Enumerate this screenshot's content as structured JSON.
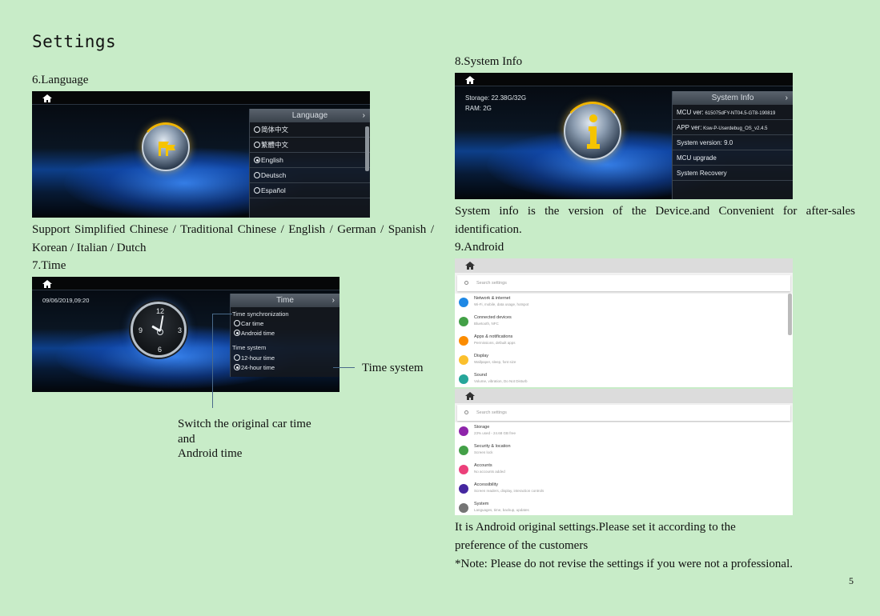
{
  "page": {
    "title": "Settings",
    "number": "5"
  },
  "language": {
    "label": "6.Language",
    "panel_title": "Language",
    "options": [
      "简体中文",
      "繁體中文",
      "English",
      "Deutsch",
      "Español"
    ],
    "selected": 2,
    "description": "Support Simplified Chinese / Traditional Chinese / English / German / Spanish / Korean / Italian / Dutch"
  },
  "time": {
    "label": "7.Time",
    "datetime": "09/06/2019,09:20",
    "panel_title": "Time",
    "sync_title": "Time synchronization",
    "sync_options": [
      "Car time",
      "Android time"
    ],
    "sync_selected": 1,
    "system_title": "Time system",
    "system_options": [
      "12-hour time",
      "24-hour time"
    ],
    "system_selected": 1,
    "callout_time_system": "Time system",
    "callout_switch_1": "Switch the original car time",
    "callout_switch_2": "and",
    "callout_switch_3": "Android time"
  },
  "system_info": {
    "label": "8.System Info",
    "storage": "Storage: 22.38G/32G",
    "ram": "RAM: 2G",
    "panel_title": "System Info",
    "rows": [
      {
        "key": "MCU ver:",
        "value": "615075dFY-NT04.5-GT8-190819"
      },
      {
        "key": "APP ver:",
        "value": "Ksw-P-Userdebug_OS_v2.4.5"
      },
      {
        "key": "System version:",
        "value": "9.0"
      },
      {
        "key": "MCU upgrade",
        "value": ""
      },
      {
        "key": "System Recovery",
        "value": ""
      }
    ],
    "description": "System info is the version of the Device.and Convenient for after-sales identification."
  },
  "android": {
    "label": "9.Android",
    "search_placeholder": "Search settings",
    "list_a": [
      {
        "title": "Network & internet",
        "sub": "Wi-Fi, mobile, data usage, hotspot",
        "color": "#1e88e5"
      },
      {
        "title": "Connected devices",
        "sub": "Bluetooth, NFC",
        "color": "#43a047"
      },
      {
        "title": "Apps & notifications",
        "sub": "Permissions, default apps",
        "color": "#fb8c00"
      },
      {
        "title": "Display",
        "sub": "Wallpaper, sleep, font size",
        "color": "#fbc02d"
      },
      {
        "title": "Sound",
        "sub": "Volume, vibration, Do Not Disturb",
        "color": "#26a69a"
      }
    ],
    "list_b": [
      {
        "title": "Storage",
        "sub": "23% used - 24.68 GB free",
        "color": "#8e24aa"
      },
      {
        "title": "Security & location",
        "sub": "Screen lock",
        "color": "#43a047"
      },
      {
        "title": "Accounts",
        "sub": "No accounts added",
        "color": "#ec407a"
      },
      {
        "title": "Accessibility",
        "sub": "Screen readers, display, interaction controls",
        "color": "#4527a0"
      },
      {
        "title": "System",
        "sub": "Languages, time, backup, updates",
        "color": "#757575"
      }
    ],
    "description_1": "It is Android original settings.Please set it according to the",
    "description_2": "preference of the customers",
    "note": "*Note: Please do not revise the settings  if you were not a professional."
  }
}
